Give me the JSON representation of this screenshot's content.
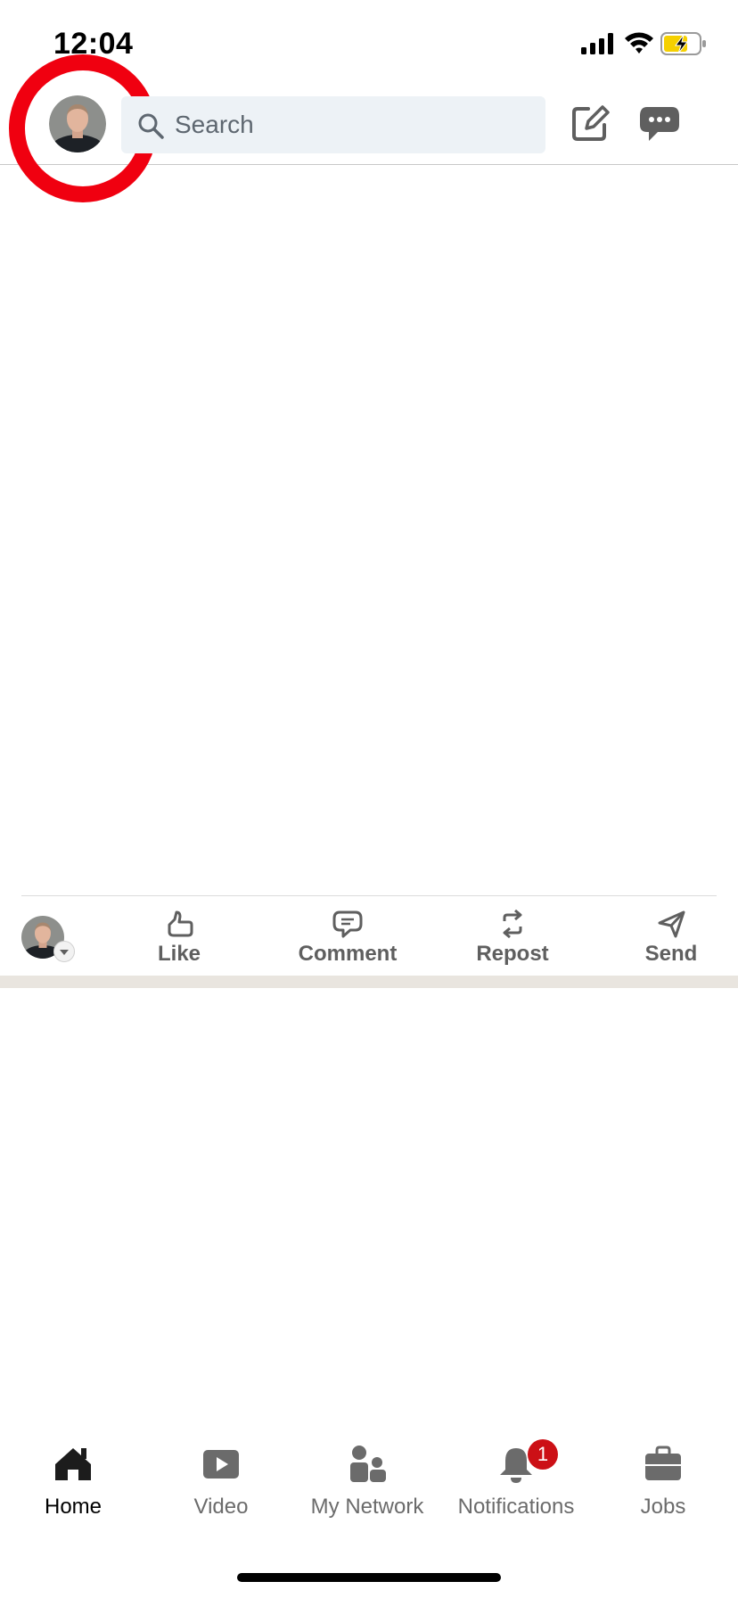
{
  "status_bar": {
    "time": "12:04",
    "signal_icon": "cellular-signal-icon",
    "wifi_icon": "wifi-icon",
    "battery_icon": "battery-charging-icon"
  },
  "top_bar": {
    "avatar_icon": "profile-avatar-icon",
    "search_placeholder": "Search",
    "search_icon": "search-icon",
    "compose_icon": "compose-post-icon",
    "messages_icon": "messaging-icon"
  },
  "actions": {
    "like": "Like",
    "comment": "Comment",
    "repost": "Repost",
    "send": "Send"
  },
  "bottom_nav": {
    "items": [
      {
        "label": "Home",
        "icon": "home-icon",
        "active": true
      },
      {
        "label": "Video",
        "icon": "video-icon"
      },
      {
        "label": "My Network",
        "icon": "network-icon"
      },
      {
        "label": "Notifications",
        "icon": "bell-icon",
        "badge": "1"
      },
      {
        "label": "Jobs",
        "icon": "briefcase-icon"
      }
    ]
  },
  "colors": {
    "highlight_ring": "#f00010",
    "badge": "#cc1016",
    "search_bg": "#edf2f6"
  }
}
